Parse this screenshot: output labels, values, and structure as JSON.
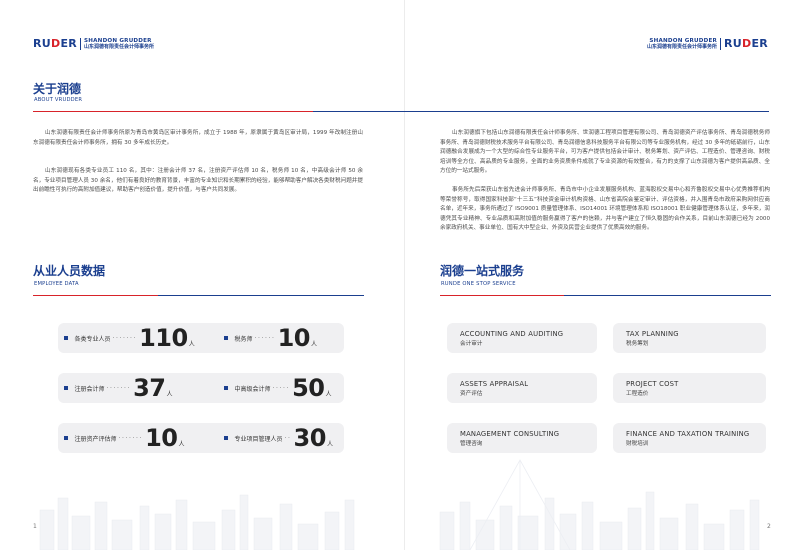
{
  "logo": {
    "mark_left": "RU",
    "mark_drop": "D",
    "mark_right": "ER",
    "name_en": "SHANDON GRUDDER",
    "name_cn": "山东润德有限责任会计师事务所"
  },
  "about": {
    "title": "关于润德",
    "subtitle": "ABOUT VRUDDER",
    "para1": "山东润德有限责任会计师事务所原为青岛市黄岛区审计事务所，成立于 1988 年，原隶属于黄岛区审计局，1999 年改制注册山东润德有限责任会计师事务所，拥有 30 多年成长历史。",
    "para2": "山东润德现有各类专业员工 110 名，其中：注册会计师 37 名，注册资产评估师 10 名，税务师 10 名，中高级会计师 50 余名，专业项目管理人员 30 余名，他们有着良好的教育背景，丰富的专业知识和长期累积的经验，能够帮助客户解决各类财税问题并提出前瞻性可执行的高附加值建议，帮助客户创造价值，提升价值，与客户共同发展。",
    "para3": "山东润德旗下包括山东润德有限责任会计师事务所、世润德工程项目管理有限公司、青岛润德资产评估事务所、青岛润德税务师事务所、青岛润德财税技术服务平台有限公司、青岛润德信息科技服务平台有限公司等专业服务机构，经过 30 多年的砥砺前行，山东润德融合发展成为一个大型的综合性专业服务平台，可为客户提供包括会计审计、税务筹划、资产评估、工程造价、管理咨询、财税培训等全方位、高品质的专业服务，全面的业务资质条件成就了专业资源的有效整合，有力的支撑了山东润德为客户提供高品质、全方位的一站式服务。",
    "para4": "事务所先后荣获山东省先进会计师事务所、青岛市中小企业发展服务机构、蓝海股权交易中心和齐鲁股权交易中心优秀推荐机构等荣誉称号，取得国家科技部“十三五”科技资金审计机构资格、山东省高院会鉴定审计、评估资格，并入围青岛市政府采购网供应商名单，近年来，事务所通过了 ISO9001 质量管理体系、ISO14001 环境管理体系和 ISO18001 职业健康管理体系认证，多年来，润德凭其专业精神、专业品质和高附加值的服务赢得了客户的信赖，并与客户建立了恒久稳固的合作关系，目前山东润德已经为 2000 余家政府机关、事业单位、国有大中型企业、外资及民营企业提供了优质高效的服务。"
  },
  "employees": {
    "title": "从业人员数据",
    "subtitle": "EMPLOYEE DATA",
    "unit": "人",
    "stats": [
      {
        "label": "各类专业人员",
        "dots": "·······",
        "value": "110"
      },
      {
        "label": "税务师",
        "dots": "······",
        "value": "10"
      },
      {
        "label": "注册会计师",
        "dots": "·······",
        "value": "37"
      },
      {
        "label": "中高级会计师",
        "dots": "·····",
        "value": "50"
      },
      {
        "label": "注册资产评估师",
        "dots": "·······",
        "value": "10"
      },
      {
        "label": "专业项目管理人员",
        "dots": "··",
        "value": "30"
      }
    ]
  },
  "services": {
    "title": "润德一站式服务",
    "subtitle": "RUNDE ONE STOP SERVICE",
    "items": [
      {
        "en": "ACCOUNTING AND AUDITING",
        "cn": "会计审计"
      },
      {
        "en": "TAX PLANNING",
        "cn": "税务筹划"
      },
      {
        "en": "ASSETS APPRAISAL",
        "cn": "资产评估"
      },
      {
        "en": "PROJECT COST",
        "cn": "工程造价"
      },
      {
        "en": "MANAGEMENT CONSULTING",
        "cn": "管理咨询"
      },
      {
        "en": "FINANCE AND TAXATION TRAINING",
        "cn": "财税培训"
      }
    ]
  },
  "pages": {
    "left": "1",
    "right": "2"
  },
  "colors": {
    "brand_blue": "#1b3f8f",
    "brand_red": "#d8232a",
    "pill_bg": "#f0f0f2"
  }
}
